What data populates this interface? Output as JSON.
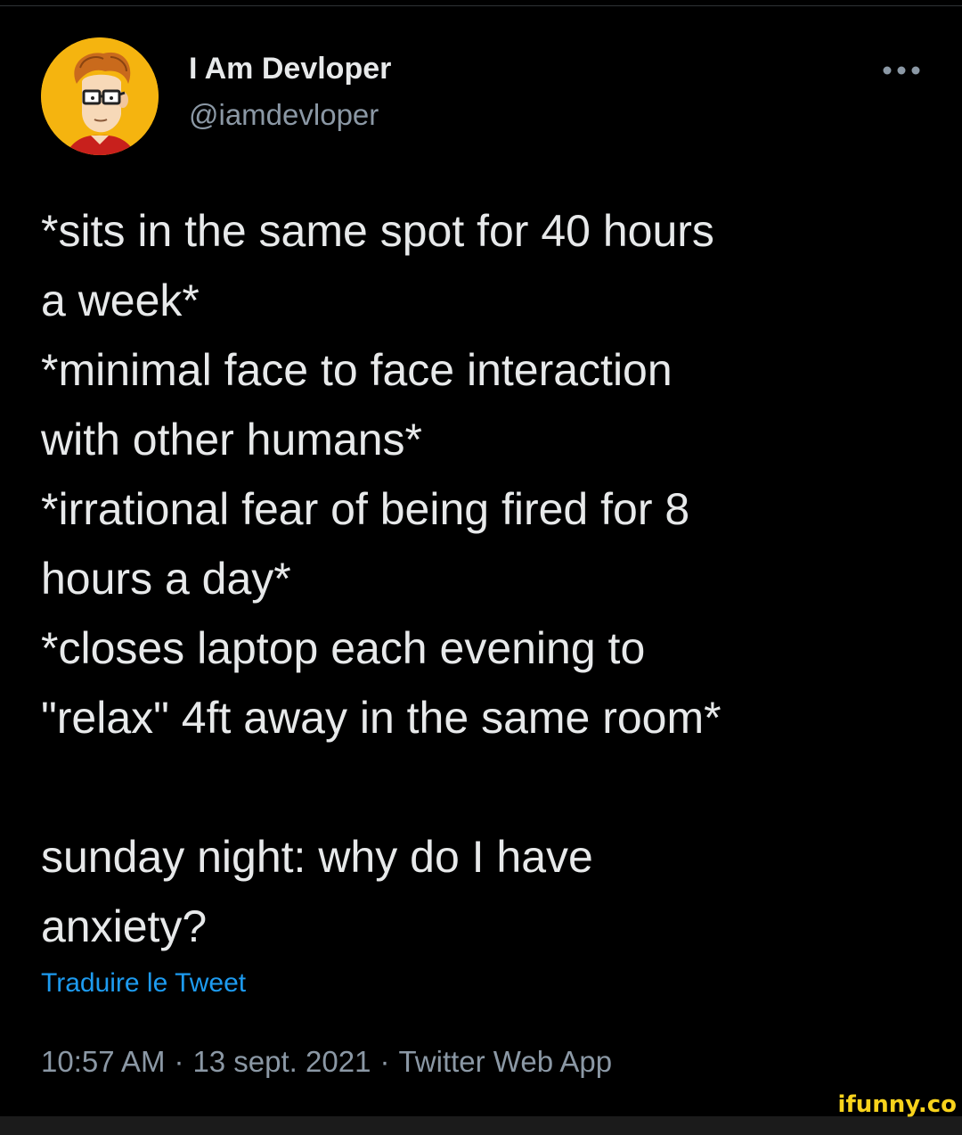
{
  "author": {
    "name": "I Am Devloper",
    "handle": "@iamdevloper"
  },
  "tweet": {
    "lines": [
      "*sits in the same spot for 40 hours",
      "a week*",
      "*minimal face to face interaction",
      "with other humans*",
      "*irrational fear of being fired for 8",
      "hours a day*",
      "*closes laptop each evening to",
      "\"relax\" 4ft away in the same room*",
      "",
      "sunday night: why do I have",
      "anxiety?"
    ],
    "translate_label": "Traduire le Tweet",
    "time": "10:57 AM",
    "date": "13 sept. 2021",
    "source": "Twitter Web App",
    "separator": "·"
  },
  "icons": {
    "more": "more-horizontal-icon",
    "avatar": "cartoon-developer-avatar"
  },
  "watermark": "ifunny.co",
  "colors": {
    "background": "#000000",
    "text": "#e7e9ea",
    "secondary": "#8b98a5",
    "link": "#1d9bf0",
    "avatar_bg": "#f5b40f",
    "watermark": "#f8d31c"
  }
}
